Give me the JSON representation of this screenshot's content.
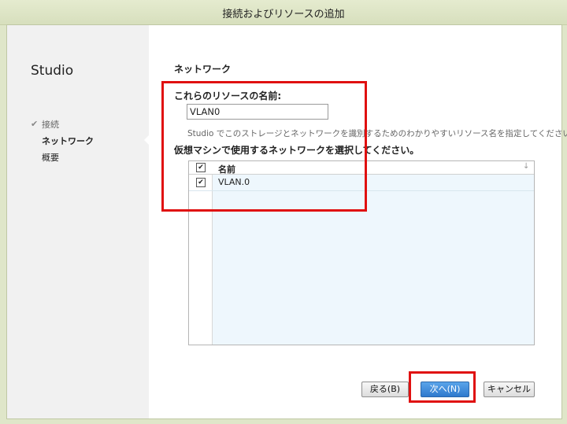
{
  "window": {
    "title": "接続およびリソースの追加"
  },
  "sidebar": {
    "app_name": "Studio",
    "steps": [
      {
        "label": "接続",
        "status": "done"
      },
      {
        "label": "ネットワーク",
        "status": "active"
      },
      {
        "label": "概要",
        "status": "pending"
      }
    ]
  },
  "main": {
    "section_title": "ネットワーク",
    "name_label": "これらのリソースの名前:",
    "name_value": "VLAN0",
    "hint": "Studio でこのストレージとネットワークを識別するためのわかりやすいリソース名を指定してください。",
    "network_label": "仮想マシンで使用するネットワークを選択してください。",
    "grid": {
      "header_checked": true,
      "column_name": "名前",
      "rows": [
        {
          "checked": true,
          "name": "VLAN.0"
        }
      ]
    }
  },
  "buttons": {
    "back": "戻る(B)",
    "next": "次へ(N)",
    "cancel": "キャンセル"
  },
  "annotation_color": "#e01010",
  "icons": {
    "check": "checkmark-icon",
    "sort": "sort-arrow-icon"
  }
}
